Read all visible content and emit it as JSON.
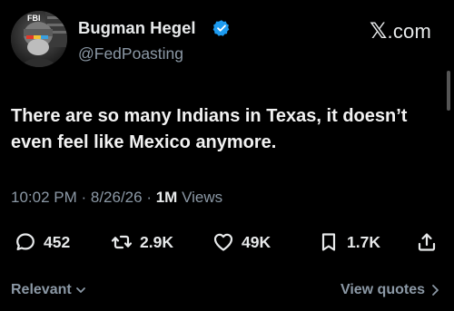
{
  "author": {
    "name": "Bugman Hegel",
    "handle": "@FedPoasting",
    "avatar_badge_text": "FBI",
    "verified": true
  },
  "brand": {
    "label": ".com",
    "glyph": "𝕏"
  },
  "tweet": {
    "text": "There are so many Indians in Texas, it doesn’t even feel like Mexico anymore."
  },
  "meta": {
    "time": "10:02 PM",
    "separator1": " · ",
    "date": "8/26/26",
    "separator2": " · ",
    "views_count": "1M",
    "views_label": " Views"
  },
  "actions": {
    "reply_count": "452",
    "repost_count": "2.9K",
    "like_count": "49K",
    "bookmark_count": "1.7K"
  },
  "footer": {
    "sort_label": "Relevant",
    "view_quotes_label": "View quotes"
  },
  "colors": {
    "background": "#000000",
    "text_primary": "#e7e9ea",
    "text_secondary": "#8b98a5",
    "verified_blue": "#1d9bf0"
  }
}
